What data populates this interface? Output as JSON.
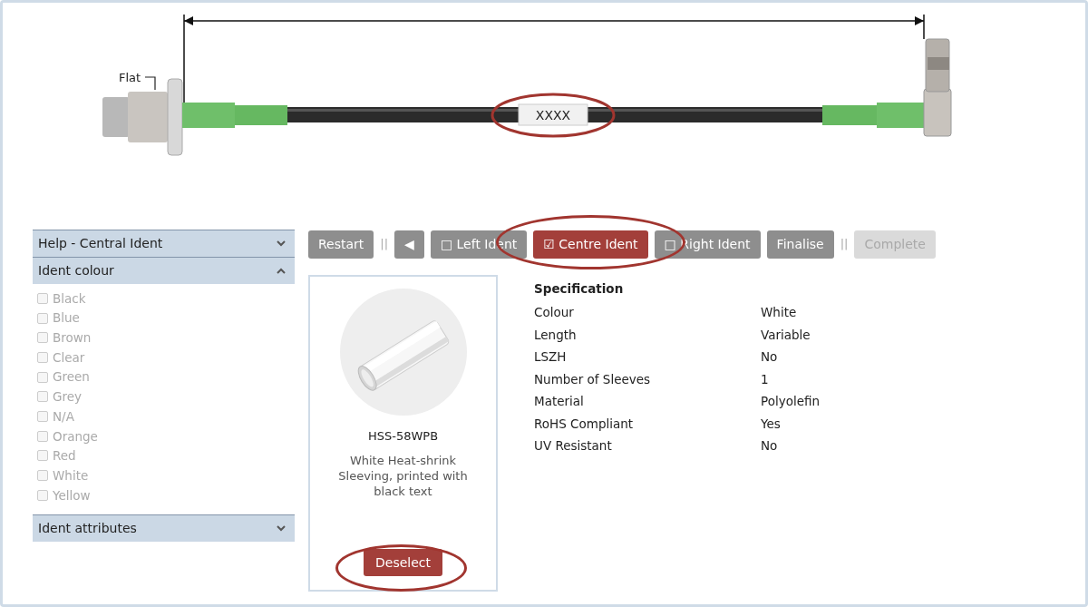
{
  "drawing": {
    "flat_label": "Flat",
    "ident_text": "XXXX",
    "ident_highlighted": true
  },
  "sidebar": {
    "sections": [
      {
        "title": "Help - Central Ident",
        "expanded": false
      },
      {
        "title": "Ident colour",
        "expanded": true,
        "options": [
          {
            "label": "Black",
            "checked": false,
            "disabled": true
          },
          {
            "label": "Blue",
            "checked": false,
            "disabled": true
          },
          {
            "label": "Brown",
            "checked": false,
            "disabled": true
          },
          {
            "label": "Clear",
            "checked": false,
            "disabled": true
          },
          {
            "label": "Green",
            "checked": false,
            "disabled": true
          },
          {
            "label": "Grey",
            "checked": false,
            "disabled": true
          },
          {
            "label": "N/A",
            "checked": false,
            "disabled": true
          },
          {
            "label": "Orange",
            "checked": false,
            "disabled": true
          },
          {
            "label": "Red",
            "checked": false,
            "disabled": true
          },
          {
            "label": "White",
            "checked": false,
            "disabled": true
          },
          {
            "label": "Yellow",
            "checked": false,
            "disabled": true
          }
        ]
      },
      {
        "title": "Ident attributes",
        "expanded": false
      }
    ]
  },
  "toolbar": [
    {
      "kind": "action",
      "label": "Restart",
      "disabled": false
    },
    {
      "kind": "separator",
      "label": "||"
    },
    {
      "kind": "action",
      "label": "◀",
      "disabled": false
    },
    {
      "kind": "step",
      "box": "□",
      "label": "Left Ident",
      "selected": false,
      "highlighted": false
    },
    {
      "kind": "step",
      "box": "☑",
      "label": "Centre Ident",
      "selected": true,
      "highlighted": true
    },
    {
      "kind": "step",
      "box": "□",
      "label": "Right Ident",
      "selected": false,
      "highlighted": false
    },
    {
      "kind": "action",
      "label": "Finalise",
      "disabled": false
    },
    {
      "kind": "separator",
      "label": "||"
    },
    {
      "kind": "action",
      "label": "Complete",
      "disabled": true
    }
  ],
  "product": {
    "kind": "picture",
    "code": "HSS-58WPB",
    "description": "White Heat-shrink Sleeving, printed with black text",
    "button": {
      "label": "Deselect",
      "highlighted": true
    }
  },
  "specification": {
    "title": "Specification",
    "rows": [
      {
        "name": "Colour",
        "value": "White"
      },
      {
        "name": "Length",
        "value": "Variable"
      },
      {
        "name": "LSZH",
        "value": "No"
      },
      {
        "name": "Number of Sleeves",
        "value": "1"
      },
      {
        "name": "Material",
        "value": "Polyolefin"
      },
      {
        "name": "RoHS Compliant",
        "value": "Yes"
      },
      {
        "name": "UV Resistant",
        "value": "No"
      }
    ]
  }
}
